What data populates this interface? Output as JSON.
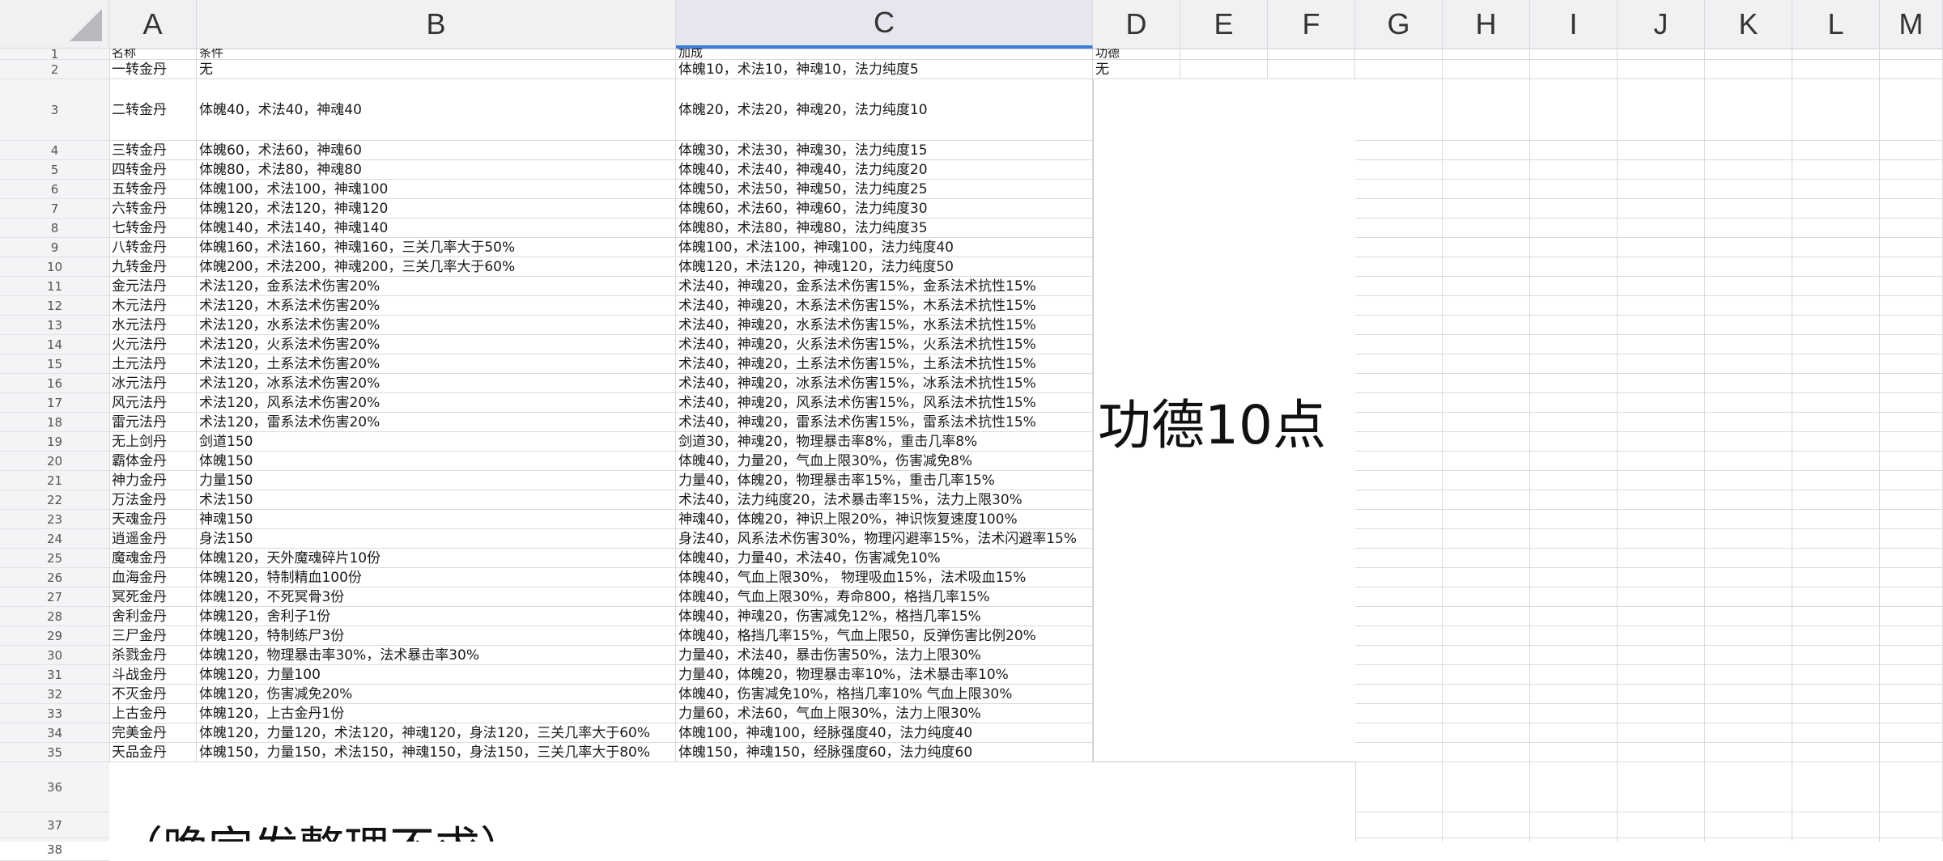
{
  "columns": [
    "A",
    "B",
    "C",
    "D",
    "E",
    "F",
    "G",
    "H",
    "I",
    "J",
    "K",
    "L",
    "M"
  ],
  "selected_column": "C",
  "rows": [
    {
      "n": "1",
      "A": "名称",
      "B": "条件",
      "C": "加成",
      "D": "功德"
    },
    {
      "n": "2",
      "A": "一转金丹",
      "B": "无",
      "C": "体魄10，术法10，神魂10，法力纯度5",
      "D": "无"
    },
    {
      "n": "3",
      "A": "二转金丹",
      "B": "体魄40，术法40，神魂40",
      "C": "体魄20，术法20，神魂20，法力纯度10"
    },
    {
      "n": "4",
      "A": "三转金丹",
      "B": "体魄60，术法60，神魂60",
      "C": "体魄30，术法30，神魂30，法力纯度15"
    },
    {
      "n": "5",
      "A": "四转金丹",
      "B": "体魄80，术法80，神魂80",
      "C": "体魄40，术法40，神魂40，法力纯度20"
    },
    {
      "n": "6",
      "A": "五转金丹",
      "B": "体魄100，术法100，神魂100",
      "C": "体魄50，术法50，神魂50，法力纯度25"
    },
    {
      "n": "7",
      "A": "六转金丹",
      "B": "体魄120，术法120，神魂120",
      "C": "体魄60，术法60，神魂60，法力纯度30"
    },
    {
      "n": "8",
      "A": "七转金丹",
      "B": "体魄140，术法140，神魂140",
      "C": "体魄80，术法80，神魂80，法力纯度35"
    },
    {
      "n": "9",
      "A": "八转金丹",
      "B": "体魄160，术法160，神魂160，三关几率大于50%",
      "C": "体魄100，术法100，神魂100，法力纯度40"
    },
    {
      "n": "10",
      "A": "九转金丹",
      "B": "体魄200，术法200，神魂200，三关几率大于60%",
      "C": "体魄120，术法120，神魂120，法力纯度50"
    },
    {
      "n": "11",
      "A": "金元法丹",
      "B": "术法120，金系法术伤害20%",
      "C": "术法40，神魂20，金系法术伤害15%，金系法术抗性15%"
    },
    {
      "n": "12",
      "A": "木元法丹",
      "B": "术法120，木系法术伤害20%",
      "C": "术法40，神魂20，木系法术伤害15%，木系法术抗性15%"
    },
    {
      "n": "13",
      "A": "水元法丹",
      "B": "术法120，水系法术伤害20%",
      "C": "术法40，神魂20，水系法术伤害15%，水系法术抗性15%"
    },
    {
      "n": "14",
      "A": "火元法丹",
      "B": "术法120，火系法术伤害20%",
      "C": "术法40，神魂20，火系法术伤害15%，火系法术抗性15%"
    },
    {
      "n": "15",
      "A": "土元法丹",
      "B": "术法120，土系法术伤害20%",
      "C": "术法40，神魂20，土系法术伤害15%，土系法术抗性15%"
    },
    {
      "n": "16",
      "A": "冰元法丹",
      "B": "术法120，冰系法术伤害20%",
      "C": "术法40，神魂20，冰系法术伤害15%，冰系法术抗性15%"
    },
    {
      "n": "17",
      "A": "风元法丹",
      "B": "术法120，风系法术伤害20%",
      "C": "术法40，神魂20，风系法术伤害15%，风系法术抗性15%"
    },
    {
      "n": "18",
      "A": "雷元法丹",
      "B": "术法120，雷系法术伤害20%",
      "C": "术法40，神魂20，雷系法术伤害15%，雷系法术抗性15%"
    },
    {
      "n": "19",
      "A": "无上剑丹",
      "B": "剑道150",
      "C": "剑道30，神魂20，物理暴击率8%，重击几率8%"
    },
    {
      "n": "20",
      "A": "霸体金丹",
      "B": "体魄150",
      "C": "体魄40，力量20，气血上限30%，伤害减免8%"
    },
    {
      "n": "21",
      "A": "神力金丹",
      "B": "力量150",
      "C": "力量40，体魄20，物理暴击率15%，重击几率15%"
    },
    {
      "n": "22",
      "A": "万法金丹",
      "B": "术法150",
      "C": "术法40，法力纯度20，法术暴击率15%，法力上限30%"
    },
    {
      "n": "23",
      "A": "天魂金丹",
      "B": "神魂150",
      "C": "神魂40，体魄20，神识上限20%，神识恢复速度100%"
    },
    {
      "n": "24",
      "A": "逍遥金丹",
      "B": "身法150",
      "C": "身法40，风系法术伤害30%，物理闪避率15%，法术闪避率15%"
    },
    {
      "n": "25",
      "A": "魔魂金丹",
      "B": "体魄120，天外魔魂碎片10份",
      "C": "体魄40，力量40，术法40，伤害减免10%"
    },
    {
      "n": "26",
      "A": "血海金丹",
      "B": "体魄120，特制精血100份",
      "C": "体魄40，气血上限30%， 物理吸血15%，法术吸血15%"
    },
    {
      "n": "27",
      "A": "冥死金丹",
      "B": "体魄120，不死冥骨3份",
      "C": "体魄40，气血上限30%，寿命800，格挡几率15%"
    },
    {
      "n": "28",
      "A": "舍利金丹",
      "B": "体魄120，舍利子1份",
      "C": "体魄40，神魂20，伤害减免12%，格挡几率15%"
    },
    {
      "n": "29",
      "A": "三尸金丹",
      "B": "体魄120，特制练尸3份",
      "C": "体魄40，格挡几率15%，气血上限50，反弹伤害比例20%"
    },
    {
      "n": "30",
      "A": "杀戮金丹",
      "B": "体魄120，物理暴击率30%，法术暴击率30%",
      "C": "力量40，术法40，暴击伤害50%，法力上限30%"
    },
    {
      "n": "31",
      "A": "斗战金丹",
      "B": "体魄120，力量100",
      "C": "力量40，体魄20，物理暴击率10%，法术暴击率10%"
    },
    {
      "n": "32",
      "A": "不灭金丹",
      "B": "体魄120，伤害减免20%",
      "C": "体魄40，伤害减免10%，格挡几率10% 气血上限30%"
    },
    {
      "n": "33",
      "A": "上古金丹",
      "B": "体魄120，上古金丹1份",
      "C": "力量60，术法60，气血上限30%，法力上限30%"
    },
    {
      "n": "34",
      "A": "完美金丹",
      "B": "体魄120，力量120，术法120，神魂120，身法120，三关几率大于60%",
      "C": "体魄100，神魂100，经脉强度40，法力纯度40"
    },
    {
      "n": "35",
      "A": "天品金丹",
      "B": "体魄150，力量150，术法150，神魂150，身法150，三关几率大于80%",
      "C": "体魄150，神魂150，经脉强度60，法力纯度60"
    },
    {
      "n": "36"
    },
    {
      "n": "37"
    },
    {
      "n": "38"
    }
  ],
  "merged_cell_text": "功德10点",
  "note_text": "（晚完发整理不求）"
}
